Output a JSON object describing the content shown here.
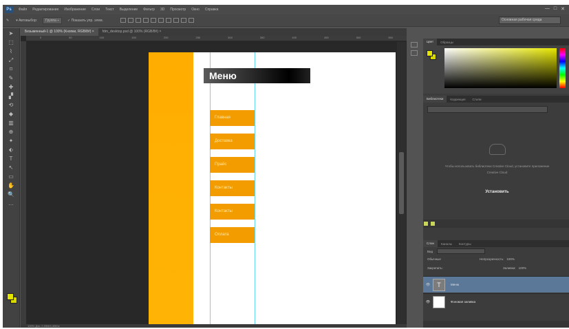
{
  "app": {
    "logo": "Ps"
  },
  "menubar": {
    "items": [
      "Файл",
      "Редактирование",
      "Изображение",
      "Слои",
      "Текст",
      "Выделение",
      "Фильтр",
      "3D",
      "Просмотр",
      "Окно",
      "Справка"
    ],
    "window_controls": [
      "—",
      "□",
      "✕"
    ]
  },
  "optionsbar": {
    "tool_glyph": "✎",
    "option1": "▾ Автовыбор:",
    "option2": "Группа ÷",
    "option3": "✓ Показать упр. элем.",
    "workspace": "Основная рабочая среда"
  },
  "toolbox": {
    "tools": [
      "➤",
      "⬚",
      "⌇",
      "⤢",
      "⌑",
      "✎",
      "✚",
      "▞",
      "⟲",
      "◆",
      "▥",
      "⊕",
      "✦",
      "⬖",
      "T",
      "↖",
      "▭",
      "✋",
      "🔍",
      "…"
    ]
  },
  "document": {
    "tabs": [
      "Безымянный-1 @ 100% (Кнопки, RGB/8#) × ",
      "fdm_desktop.psd @ 100% (RGB/8#) ×"
    ],
    "ruler_ticks": [
      "0",
      "50",
      "100",
      "150",
      "200",
      "250",
      "300",
      "350",
      "400",
      "450",
      "500",
      "550"
    ],
    "status": "100%    Док: 2,99M/4,40M    ▸"
  },
  "canvas": {
    "menu_title": "Меню",
    "buttons": [
      "Главная",
      "Доставка",
      "Прайс",
      "Контакты",
      "Контакты",
      "Оплата"
    ]
  },
  "color_panel": {
    "tabs": [
      "Цвет",
      "Образцы"
    ],
    "fg": "#e5e500"
  },
  "library_panel": {
    "tabs": [
      "Библиотеки",
      "Коррекция",
      "Стили"
    ],
    "text": "Чтобы использовать библиотеки Creative Cloud, установите приложение Creative Cloud",
    "install": "Установить"
  },
  "layers_panel": {
    "tabs": [
      "Слои",
      "Каналы",
      "Контуры"
    ],
    "kind": "Вид",
    "blend": "Обычные",
    "opacity_label": "Непрозрачность:",
    "opacity": "100%",
    "lock_label": "Закрепить:",
    "fill_label": "Заливка:",
    "fill": "100%",
    "layers": [
      {
        "name": "Меню",
        "thumb": "T"
      },
      {
        "name": "Фоновая заливка"
      }
    ],
    "eye": "👁"
  }
}
